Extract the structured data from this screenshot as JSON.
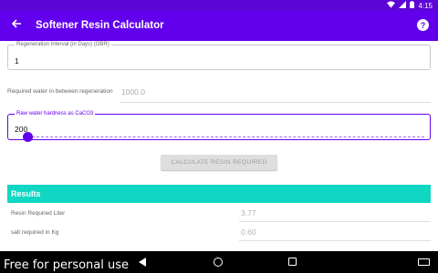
{
  "status_bar": {
    "time": "4:15"
  },
  "app_bar": {
    "title": "Softener Resin Calculator",
    "help": "?"
  },
  "form": {
    "regeneration_interval": {
      "label": "Regeneration Interval (in Days) (OBR)",
      "value": "1"
    },
    "required_water": {
      "label": "Required water in between regeneration",
      "value": "1000.0"
    },
    "raw_water_hardness": {
      "label": "Raw water hardness as CaCO3",
      "value": "200"
    },
    "calculate_button": "CALCULATE RESIN REQUIRED"
  },
  "results": {
    "title": "Results",
    "rows": [
      {
        "label": "Resin Required Liter",
        "value": "3.77"
      },
      {
        "label": "salt required in Kg",
        "value": "0.60"
      }
    ]
  },
  "watermark": "Free for personal use",
  "colors": {
    "primary": "#6200ee",
    "status_bar": "#5c05d6",
    "results_header": "#10d6c4"
  }
}
